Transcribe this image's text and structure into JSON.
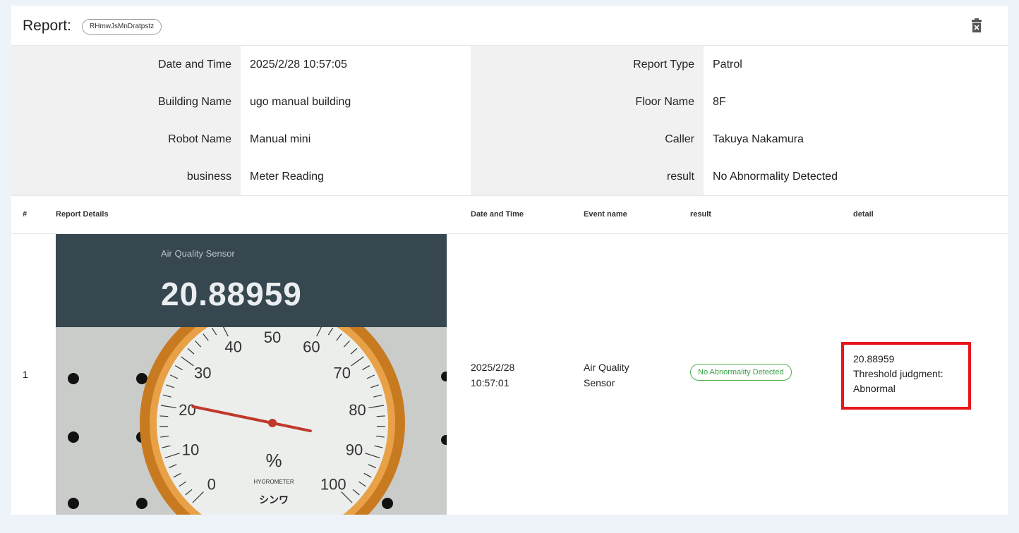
{
  "header": {
    "title": "Report:",
    "report_id": "RHmwJsMnDratpstz",
    "delete_icon": "trash-icon"
  },
  "info": {
    "rows": [
      {
        "label1": "Date and Time",
        "value1": "2025/2/28 10:57:05",
        "label2": "Report Type",
        "value2": "Patrol"
      },
      {
        "label1": "Building Name",
        "value1": "ugo manual building",
        "label2": "Floor Name",
        "value2": "8F"
      },
      {
        "label1": "Robot Name",
        "value1": "Manual mini",
        "label2": "Caller",
        "value2": "Takuya Nakamura"
      },
      {
        "label1": "business",
        "value1": "Meter Reading",
        "label2": "result",
        "value2": "No Abnormality Detected"
      }
    ]
  },
  "table": {
    "headers": {
      "num": "#",
      "details": "Report Details",
      "datetime": "Date and Time",
      "event": "Event name",
      "result": "result",
      "detail": "detail"
    },
    "rows": [
      {
        "num": "1",
        "photo_label": "Air Quality Sensor",
        "photo_value": "20.88959",
        "date": "2025/2/28",
        "time": "10:57:01",
        "event_line1": "Air Quality",
        "event_line2": "Sensor",
        "result": "No Abnormality Detected",
        "detail_line1": "20.88959",
        "detail_line2": "Threshold judgment:",
        "detail_line3": "Abnormal"
      }
    ]
  },
  "gauge": {
    "ticks": [
      "0",
      "10",
      "20",
      "30",
      "40",
      "50",
      "60",
      "70",
      "80",
      "90",
      "100"
    ],
    "unit": "%",
    "brand": "HYGROMETER",
    "maker": "シンワ",
    "needle_value_percent": 21
  },
  "colors": {
    "highlight_border": "#e8161b",
    "badge_green": "#4caf50",
    "photo_header": "#37474f",
    "gauge_ring": "#d98a2b"
  }
}
